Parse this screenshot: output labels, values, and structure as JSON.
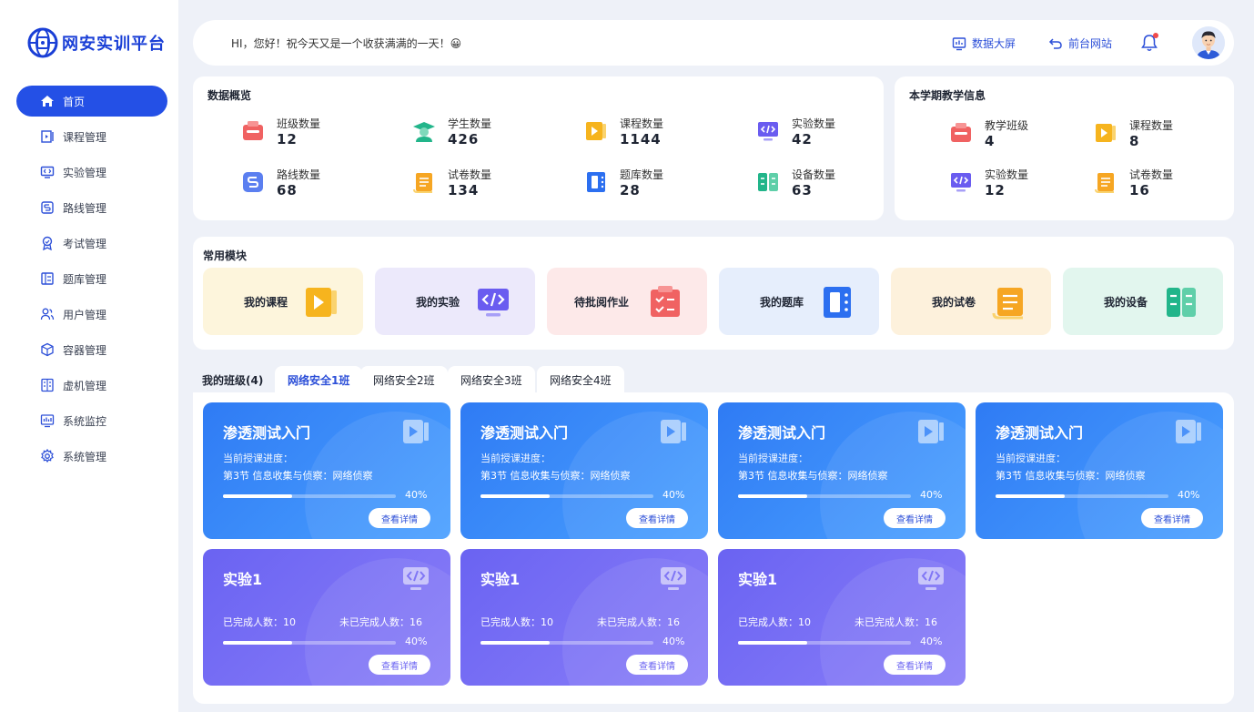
{
  "app": {
    "logo_text": "网安实训平台"
  },
  "sidebar": {
    "items": [
      {
        "label": "首页",
        "icon": "home-icon"
      },
      {
        "label": "课程管理",
        "icon": "course-icon"
      },
      {
        "label": "实验管理",
        "icon": "code-icon"
      },
      {
        "label": "路线管理",
        "icon": "route-icon"
      },
      {
        "label": "考试管理",
        "icon": "exam-icon"
      },
      {
        "label": "题库管理",
        "icon": "question-bank-icon"
      },
      {
        "label": "用户管理",
        "icon": "users-icon"
      },
      {
        "label": "容器管理",
        "icon": "container-icon"
      },
      {
        "label": "虚机管理",
        "icon": "vm-icon"
      },
      {
        "label": "系统监控",
        "icon": "monitor-icon"
      },
      {
        "label": "系统管理",
        "icon": "gear-icon"
      }
    ]
  },
  "header": {
    "greeting": "HI，您好！祝今天又是一个收获满满的一天！😀",
    "data_screen": "数据大屏",
    "front_site": "前台网站"
  },
  "overview": {
    "title": "数据概览",
    "stats": [
      {
        "label": "班级数量",
        "value": "12"
      },
      {
        "label": "学生数量",
        "value": "426"
      },
      {
        "label": "课程数量",
        "value": "1144"
      },
      {
        "label": "实验数量",
        "value": "42"
      },
      {
        "label": "路线数量",
        "value": "68"
      },
      {
        "label": "试卷数量",
        "value": "134"
      },
      {
        "label": "题库数量",
        "value": "28"
      },
      {
        "label": "设备数量",
        "value": "63"
      }
    ]
  },
  "semester": {
    "title": "本学期教学信息",
    "stats": [
      {
        "label": "教学班级",
        "value": "4"
      },
      {
        "label": "课程数量",
        "value": "8"
      },
      {
        "label": "实验数量",
        "value": "12"
      },
      {
        "label": "试卷数量",
        "value": "16"
      }
    ]
  },
  "modules": {
    "title": "常用模块",
    "items": [
      {
        "label": "我的课程",
        "bg": "#fdf5dc"
      },
      {
        "label": "我的实验",
        "bg": "#ece9fb"
      },
      {
        "label": "待批阅作业",
        "bg": "#fde9e9"
      },
      {
        "label": "我的题库",
        "bg": "#e6eefc"
      },
      {
        "label": "我的试卷",
        "bg": "#fdf1dc"
      },
      {
        "label": "我的设备",
        "bg": "#e2f6ee"
      }
    ]
  },
  "classes": {
    "label": "我的班级(4)",
    "tabs": [
      "网络安全1班",
      "网络安全2班",
      "网络安全3班",
      "网络安全4班"
    ],
    "course_cards": [
      {
        "title": "渗透测试入门",
        "line1": "当前授课进度：",
        "line2": "第3节 信息收集与侦察：网络侦察",
        "progress": 0.4,
        "pct": "40%",
        "button": "查看详情"
      },
      {
        "title": "渗透测试入门",
        "line1": "当前授课进度：",
        "line2": "第3节 信息收集与侦察：网络侦察",
        "progress": 0.4,
        "pct": "40%",
        "button": "查看详情"
      },
      {
        "title": "渗透测试入门",
        "line1": "当前授课进度：",
        "line2": "第3节 信息收集与侦察：网络侦察",
        "progress": 0.4,
        "pct": "40%",
        "button": "查看详情"
      },
      {
        "title": "渗透测试入门",
        "line1": "当前授课进度：",
        "line2": "第3节 信息收集与侦察：网络侦察",
        "progress": 0.4,
        "pct": "40%",
        "button": "查看详情"
      }
    ],
    "lab_cards": [
      {
        "title": "实验1",
        "done": "已完成人数：10",
        "undone": "未已完成人数：16",
        "progress": 0.4,
        "pct": "40%",
        "button": "查看详情"
      },
      {
        "title": "实验1",
        "done": "已完成人数：10",
        "undone": "未已完成人数：16",
        "progress": 0.4,
        "pct": "40%",
        "button": "查看详情"
      },
      {
        "title": "实验1",
        "done": "已完成人数：10",
        "undone": "未已完成人数：16",
        "progress": 0.4,
        "pct": "40%",
        "button": "查看详情"
      }
    ]
  }
}
